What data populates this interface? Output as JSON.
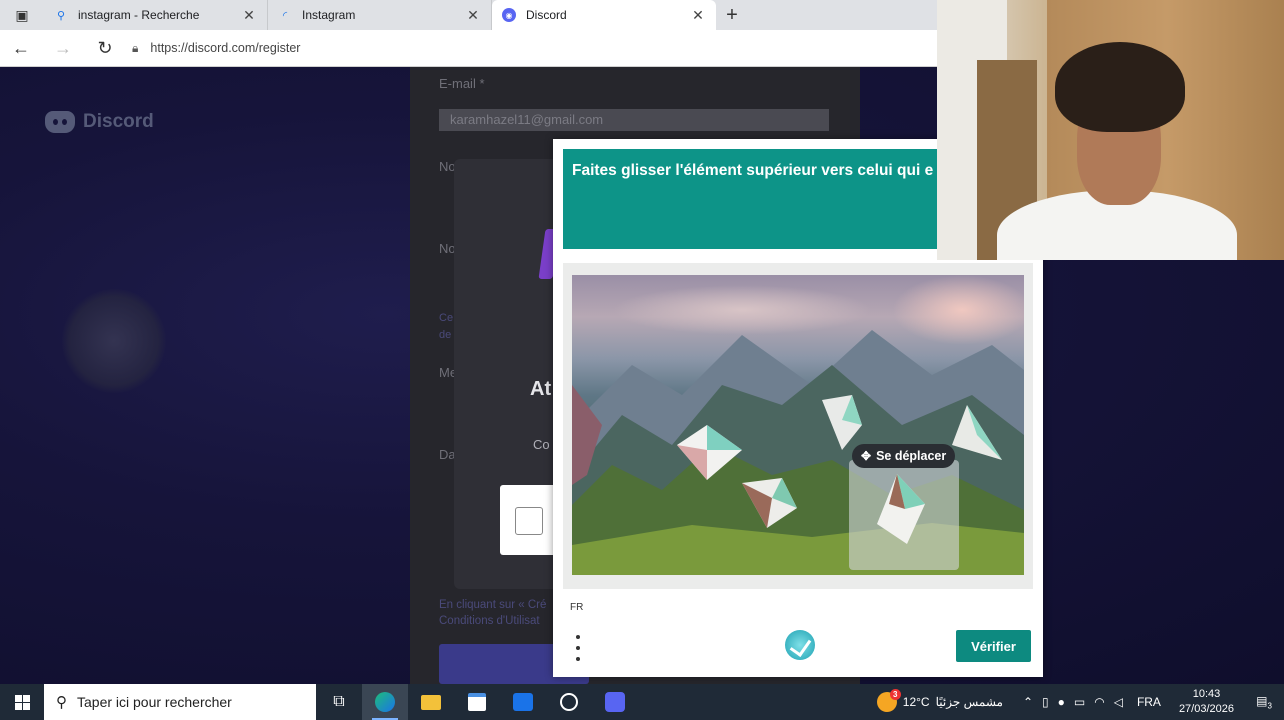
{
  "browser": {
    "tabs": [
      {
        "label": "instagram - Recherche",
        "icon": "search-icon"
      },
      {
        "label": "Instagram",
        "icon": "loading-icon"
      },
      {
        "label": "Discord",
        "icon": "discord-icon"
      }
    ],
    "active_tab": 2,
    "url": "https://discord.com/register"
  },
  "discord": {
    "brand": "Discord",
    "email_label": "E-mail *",
    "email_value": "karamhazel11@gmail.com",
    "partial_labels": [
      "No",
      "No",
      "Me",
      "Da"
    ],
    "modal_title_partial": "At",
    "modal_text_partial": "Co",
    "legal_line1": "En cliquant sur « Cré",
    "legal_line2": "Conditions d'Utilisat",
    "partial_note_line1": "Ce",
    "partial_note_line2": "de"
  },
  "captcha": {
    "prompt": "Faites glisser l'élément supérieur vers celui qui e similaire",
    "move_label": "Se déplacer",
    "language": "FR",
    "verify_label": "Vérifier",
    "accent_color": "#0d9488"
  },
  "taskbar": {
    "search_placeholder": "Taper ici pour rechercher",
    "weather_temp": "12°C",
    "weather_text": "مشمس جزئيًا",
    "weather_badge": "3",
    "language": "FRA",
    "time": "10:43",
    "date": "27/03/2026",
    "notification_count": "3"
  }
}
